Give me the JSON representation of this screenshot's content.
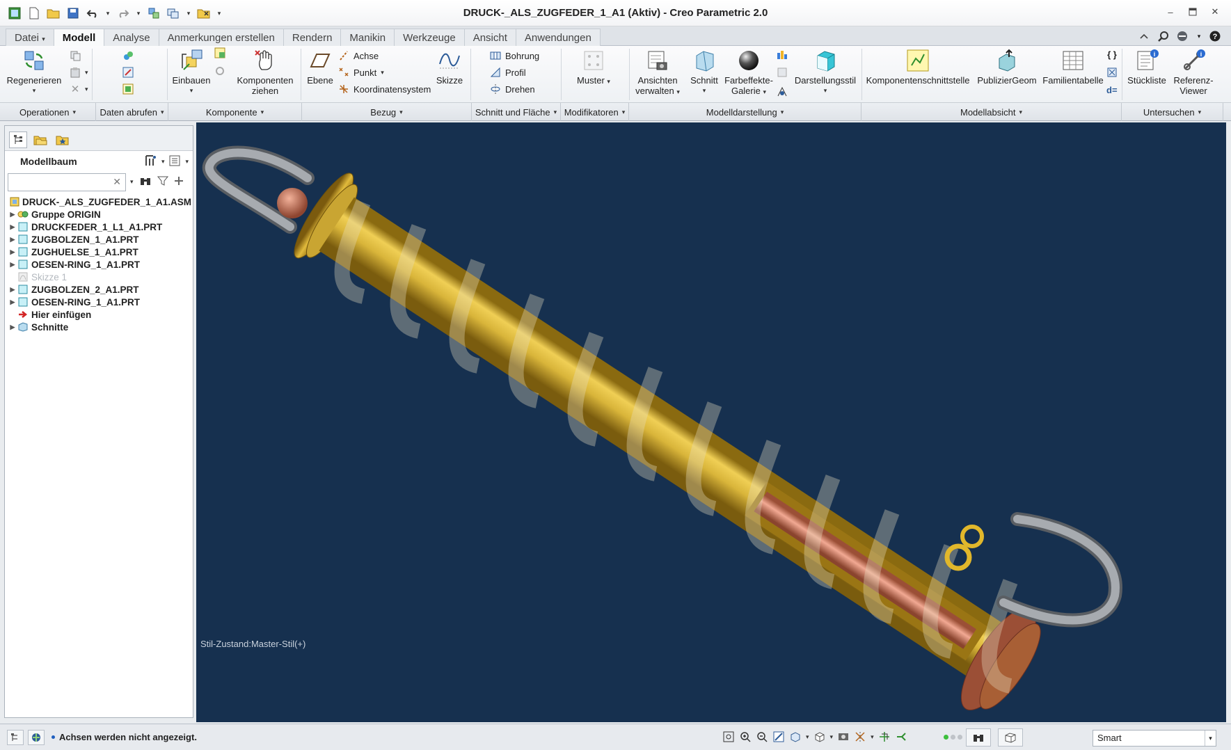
{
  "window": {
    "title": "DRUCK-_ALS_ZUGFEDER_1_A1 (Aktiv) - Creo Parametric 2.0"
  },
  "ribbon_tabs": [
    "Datei",
    "Modell",
    "Analyse",
    "Anmerkungen erstellen",
    "Rendern",
    "Manikin",
    "Werkzeuge",
    "Ansicht",
    "Anwendungen"
  ],
  "ribbon": {
    "regenerieren": "Regenerieren",
    "einbauen": "Einbauen",
    "komponenten_ziehen_1": "Komponenten",
    "komponenten_ziehen_2": "ziehen",
    "ebene": "Ebene",
    "achse": "Achse",
    "punkt": "Punkt",
    "koordinatensystem": "Koordinatensystem",
    "skizze": "Skizze",
    "bohrung": "Bohrung",
    "profil": "Profil",
    "drehen": "Drehen",
    "muster": "Muster",
    "ansichten_1": "Ansichten",
    "ansichten_2": "verwalten",
    "schnitt": "Schnitt",
    "farbeffekte_1": "Farbeffekte-",
    "farbeffekte_2": "Galerie",
    "darstellungsstil": "Darstellungsstil",
    "komponentenschnittstelle": "Komponentenschnittstelle",
    "publiziergeom": "PublizierGeom",
    "familientabelle": "Familientabelle",
    "stueckliste": "Stückliste",
    "referenz_1": "Referenz-",
    "referenz_2": "Viewer",
    "d_eq": "d="
  },
  "groups": [
    "Operationen",
    "Daten abrufen",
    "Komponente",
    "Bezug",
    "Schnitt und Fläche",
    "Modifikatoren",
    "Modelldarstellung",
    "Modellabsicht",
    "Untersuchen"
  ],
  "model_tree": {
    "header": "Modellbaum",
    "search_value": "",
    "items": [
      {
        "label": "DRUCK-_ALS_ZUGFEDER_1_A1.ASM"
      },
      {
        "label": "Gruppe ORIGIN"
      },
      {
        "label": "DRUCKFEDER_1_L1_A1.PRT"
      },
      {
        "label": "ZUGBOLZEN_1_A1.PRT"
      },
      {
        "label": "ZUGHUELSE_1_A1.PRT"
      },
      {
        "label": "OESEN-RING_1_A1.PRT"
      },
      {
        "label": "Skizze 1"
      },
      {
        "label": "ZUGBOLZEN_2_A1.PRT"
      },
      {
        "label": "OESEN-RING_1_A1.PRT"
      },
      {
        "label": "Hier einfügen"
      },
      {
        "label": "Schnitte"
      }
    ]
  },
  "viewport": {
    "style_state": "Stil-Zustand:Master-Stil(+)",
    "background": "#16304f"
  },
  "statusbar": {
    "message": "Achsen werden nicht angezeigt.",
    "filter_value": "Smart"
  },
  "colors": {
    "accent_blue": "#1f5fbf",
    "tube_gold": "#d9b53a",
    "copper": "#c9765c"
  }
}
